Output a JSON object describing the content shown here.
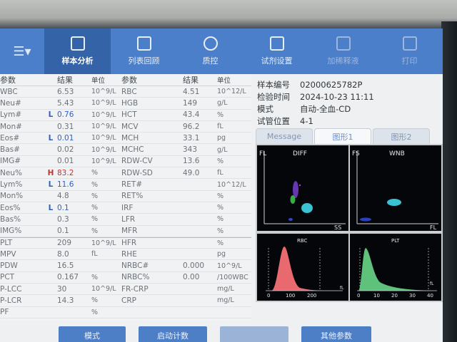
{
  "toolbar": {
    "items": [
      {
        "label": "样本分析",
        "icon": "monitor-icon",
        "active": true
      },
      {
        "label": "列表回顾",
        "icon": "clipboard-icon"
      },
      {
        "label": "质控",
        "icon": "balance-icon"
      },
      {
        "label": "试剂设置",
        "icon": "reagent-bottle-icon"
      },
      {
        "label": "加稀释液",
        "icon": "flask-icon"
      },
      {
        "label": "打印",
        "icon": "printer-icon"
      }
    ]
  },
  "table": {
    "headers": {
      "param": "参数",
      "result": "结果",
      "unit": "单位",
      "param2": "参数",
      "result2": "结果",
      "unit2": "单位"
    },
    "rows": [
      {
        "p1": "WBC",
        "f1": "",
        "r1": "6.53",
        "u1": "10^9/L",
        "p2": "RBC",
        "r2": "4.51",
        "u2": "10^12/L"
      },
      {
        "p1": "Neu#",
        "f1": "",
        "r1": "5.43",
        "u1": "10^9/L",
        "p2": "HGB",
        "r2": "149",
        "u2": "g/L"
      },
      {
        "p1": "Lym#",
        "f1": "L",
        "r1": "0.76",
        "u1": "10^9/L",
        "p2": "HCT",
        "r2": "43.4",
        "u2": "%"
      },
      {
        "p1": "Mon#",
        "f1": "",
        "r1": "0.31",
        "u1": "10^9/L",
        "p2": "MCV",
        "r2": "96.2",
        "u2": "fL"
      },
      {
        "p1": "Eos#",
        "f1": "L",
        "r1": "0.01",
        "u1": "10^9/L",
        "p2": "MCH",
        "r2": "33.1",
        "u2": "pg"
      },
      {
        "p1": "Bas#",
        "f1": "",
        "r1": "0.02",
        "u1": "10^9/L",
        "p2": "MCHC",
        "r2": "343",
        "u2": "g/L"
      },
      {
        "p1": "IMG#",
        "f1": "",
        "r1": "0.01",
        "u1": "10^9/L",
        "p2": "RDW-CV",
        "r2": "13.6",
        "u2": "%"
      },
      {
        "p1": "Neu%",
        "f1": "H",
        "r1": "83.2",
        "u1": "%",
        "p2": "RDW-SD",
        "r2": "49.0",
        "u2": "fL"
      },
      {
        "p1": "Lym%",
        "f1": "L",
        "r1": "11.6",
        "u1": "%",
        "p2": "RET#",
        "r2": "",
        "u2": "10^12/L"
      },
      {
        "p1": "Mon%",
        "f1": "",
        "r1": "4.8",
        "u1": "%",
        "p2": "RET%",
        "r2": "",
        "u2": "%"
      },
      {
        "p1": "Eos%",
        "f1": "L",
        "r1": "0.1",
        "u1": "%",
        "p2": "IRF",
        "r2": "",
        "u2": "%"
      },
      {
        "p1": "Bas%",
        "f1": "",
        "r1": "0.3",
        "u1": "%",
        "p2": "LFR",
        "r2": "",
        "u2": "%"
      },
      {
        "p1": "IMG%",
        "f1": "",
        "r1": "0.1",
        "u1": "%",
        "p2": "MFR",
        "r2": "",
        "u2": "%"
      },
      {
        "p1": "PLT",
        "f1": "",
        "r1": "209",
        "u1": "10^9/L",
        "p2": "HFR",
        "r2": "",
        "u2": "%"
      },
      {
        "p1": "MPV",
        "f1": "",
        "r1": "8.0",
        "u1": "fL",
        "p2": "RHE",
        "r2": "",
        "u2": "pg"
      },
      {
        "p1": "PDW",
        "f1": "",
        "r1": "16.5",
        "u1": "",
        "p2": "NRBC#",
        "r2": "0.000",
        "u2": "10^9/L"
      },
      {
        "p1": "PCT",
        "f1": "",
        "r1": "0.167",
        "u1": "%",
        "p2": "NRBC%",
        "r2": "0.00",
        "u2": "/100WBC"
      },
      {
        "p1": "P-LCC",
        "f1": "",
        "r1": "30",
        "u1": "10^9/L",
        "p2": "FR-CRP",
        "r2": "",
        "u2": "mg/L"
      },
      {
        "p1": "P-LCR",
        "f1": "",
        "r1": "14.3",
        "u1": "%",
        "p2": "CRP",
        "r2": "",
        "u2": "mg/L"
      },
      {
        "p1": "PF",
        "f1": "",
        "r1": "",
        "u1": "%",
        "p2": "",
        "r2": "",
        "u2": ""
      }
    ]
  },
  "info": {
    "sample_no_label": "样本编号",
    "sample_no": "02000625782P",
    "time_label": "检验时间",
    "time": "2024-10-23 11:11",
    "mode_label": "模式",
    "mode": "自动-全血-CD",
    "position_label": "试管位置",
    "position": "4-1"
  },
  "tabs": [
    {
      "label": "Message",
      "active": false
    },
    {
      "label": "图形1",
      "active": true
    },
    {
      "label": "图形2",
      "active": false
    }
  ],
  "plots": {
    "diff": {
      "title": "DIFF",
      "y_axis": "FL",
      "x_axis": "SS"
    },
    "wnb": {
      "title": "WNB",
      "y_axis": "FS",
      "x_axis": "FL"
    },
    "rbc": {
      "title": "RBC",
      "axis_unit": "fL",
      "ticks": [
        "0",
        "100",
        "200"
      ],
      "color": "#e86a6e"
    },
    "plt": {
      "title": "PLT",
      "axis_unit": "fL",
      "ticks": [
        "0",
        "10",
        "20",
        "30",
        "40"
      ],
      "color": "#5fc27a"
    }
  },
  "buttons": [
    {
      "label": "模式",
      "enabled": true
    },
    {
      "label": "启动计数",
      "enabled": true
    },
    {
      "label": "",
      "enabled": false
    },
    {
      "label": "其他参数",
      "enabled": true
    }
  ]
}
